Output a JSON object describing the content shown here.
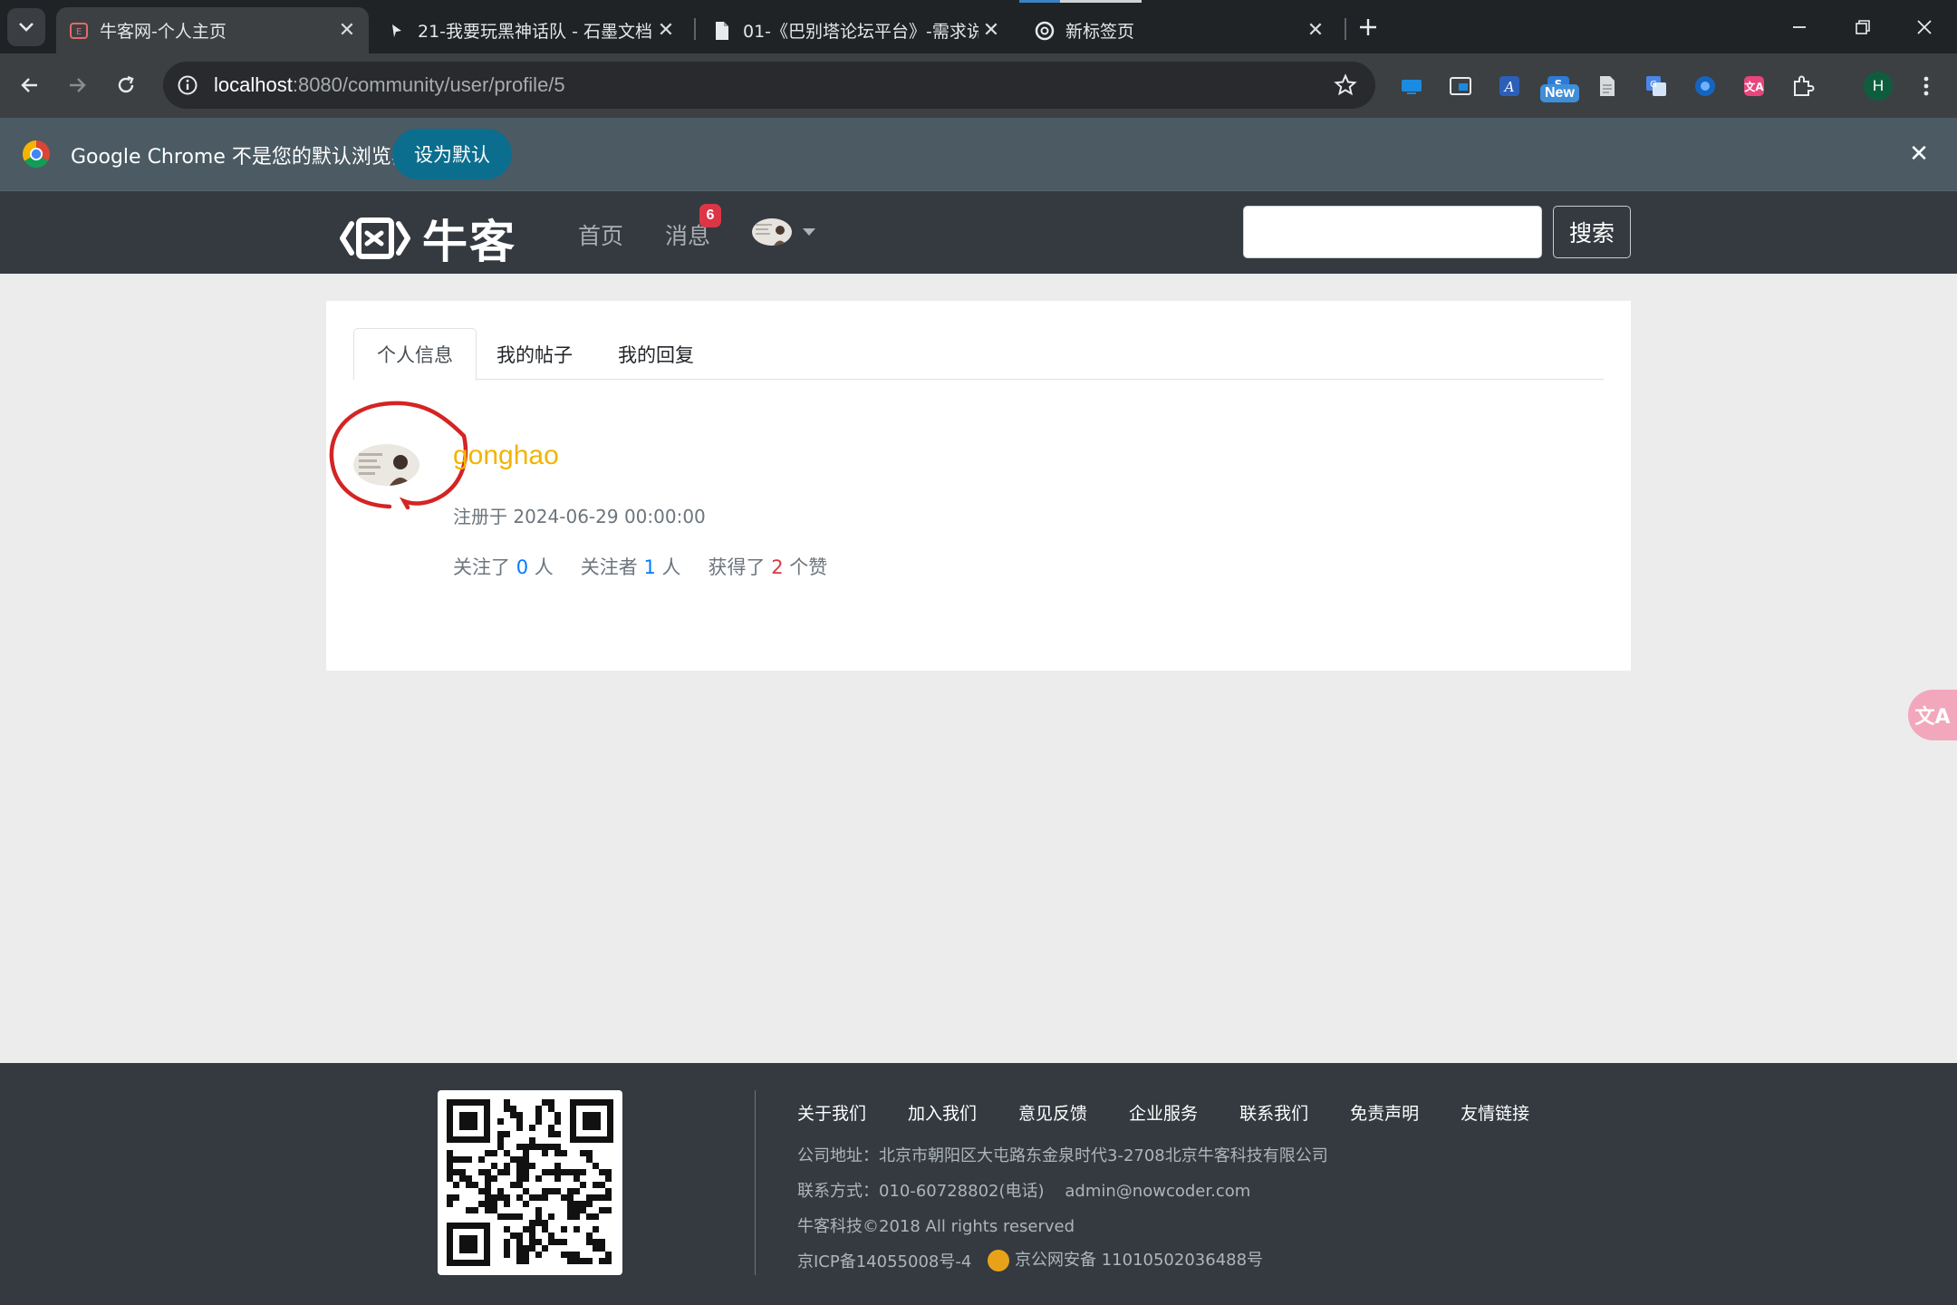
{
  "browser": {
    "tabs": [
      {
        "title": "牛客网-个人主页",
        "active": true
      },
      {
        "title": "21-我要玩黑神话队 - 石墨文档",
        "active": false
      },
      {
        "title": "01-《巴别塔论坛平台》-需求说",
        "active": false
      },
      {
        "title": "新标签页",
        "active": false
      }
    ],
    "url_host": "localhost",
    "url_path": ":8080/community/user/profile/5",
    "extension_new_badge": "New",
    "profile_initial": "H",
    "infobar": {
      "text": "Google Chrome 不是您的默认浏览器",
      "button": "设为默认"
    }
  },
  "site": {
    "brand": "牛客",
    "nav": {
      "home": "首页",
      "messages": "消息",
      "message_count": "6"
    },
    "search": {
      "placeholder": "",
      "button": "搜索"
    }
  },
  "profile": {
    "tabs": [
      "个人信息",
      "我的帖子",
      "我的回复"
    ],
    "username": "gonghao",
    "registered_label": "注册于 2024-06-29 00:00:00",
    "stats": {
      "following_prefix": "关注了",
      "following_count": "0",
      "following_suffix": "人",
      "followers_prefix": "关注者",
      "followers_count": "1",
      "followers_suffix": "人",
      "likes_prefix": "获得了",
      "likes_count": "2",
      "likes_suffix": "个赞"
    }
  },
  "footer": {
    "links": [
      "关于我们",
      "加入我们",
      "意见反馈",
      "企业服务",
      "联系我们",
      "免责声明",
      "友情链接"
    ],
    "address": "公司地址：北京市朝阳区大屯路东金泉时代3-2708北京牛客科技有限公司",
    "contact": "联系方式：010-60728802(电话)    admin@nowcoder.com",
    "copyright": "牛客科技©2018 All rights reserved",
    "icp": "京ICP备14055008号-4",
    "police": "京公网安备 11010502036488号"
  },
  "colors": {
    "username": "#f2b400",
    "header_bg": "#343a40",
    "badge": "#dc3545",
    "link_blue": "#007bff"
  }
}
